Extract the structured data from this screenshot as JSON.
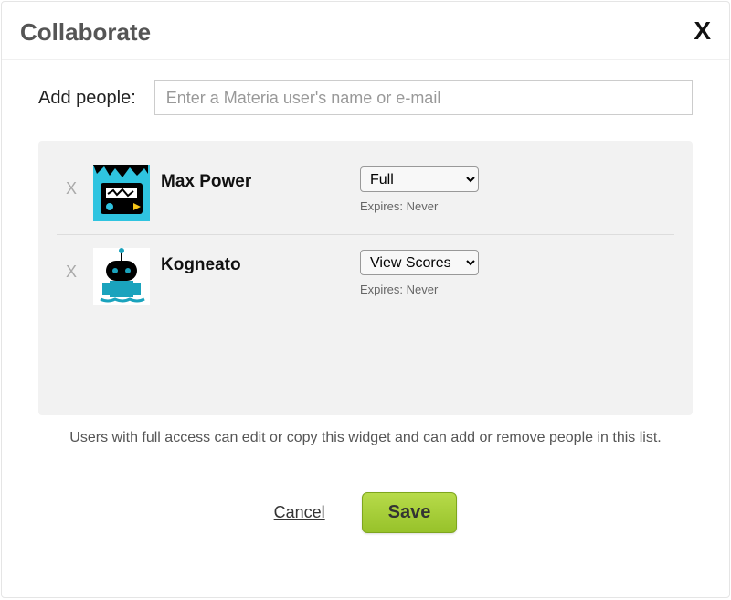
{
  "dialog": {
    "title": "Collaborate",
    "close_label": "X"
  },
  "add_people": {
    "label": "Add people:",
    "placeholder": "Enter a Materia user's name or e-mail"
  },
  "people": [
    {
      "name": "Max Power",
      "permission": "Full",
      "expires_label": "Expires:",
      "expires_value": "Never",
      "expires_underlined": false,
      "remove_label": "X"
    },
    {
      "name": "Kogneato",
      "permission": "View Scores",
      "expires_label": "Expires:",
      "expires_value": "Never",
      "expires_underlined": true,
      "remove_label": "X"
    }
  ],
  "permission_options": [
    "Full",
    "View Scores"
  ],
  "help_text": "Users with full access can edit or copy this widget and can add or remove people in this list.",
  "buttons": {
    "cancel": "Cancel",
    "save": "Save"
  }
}
